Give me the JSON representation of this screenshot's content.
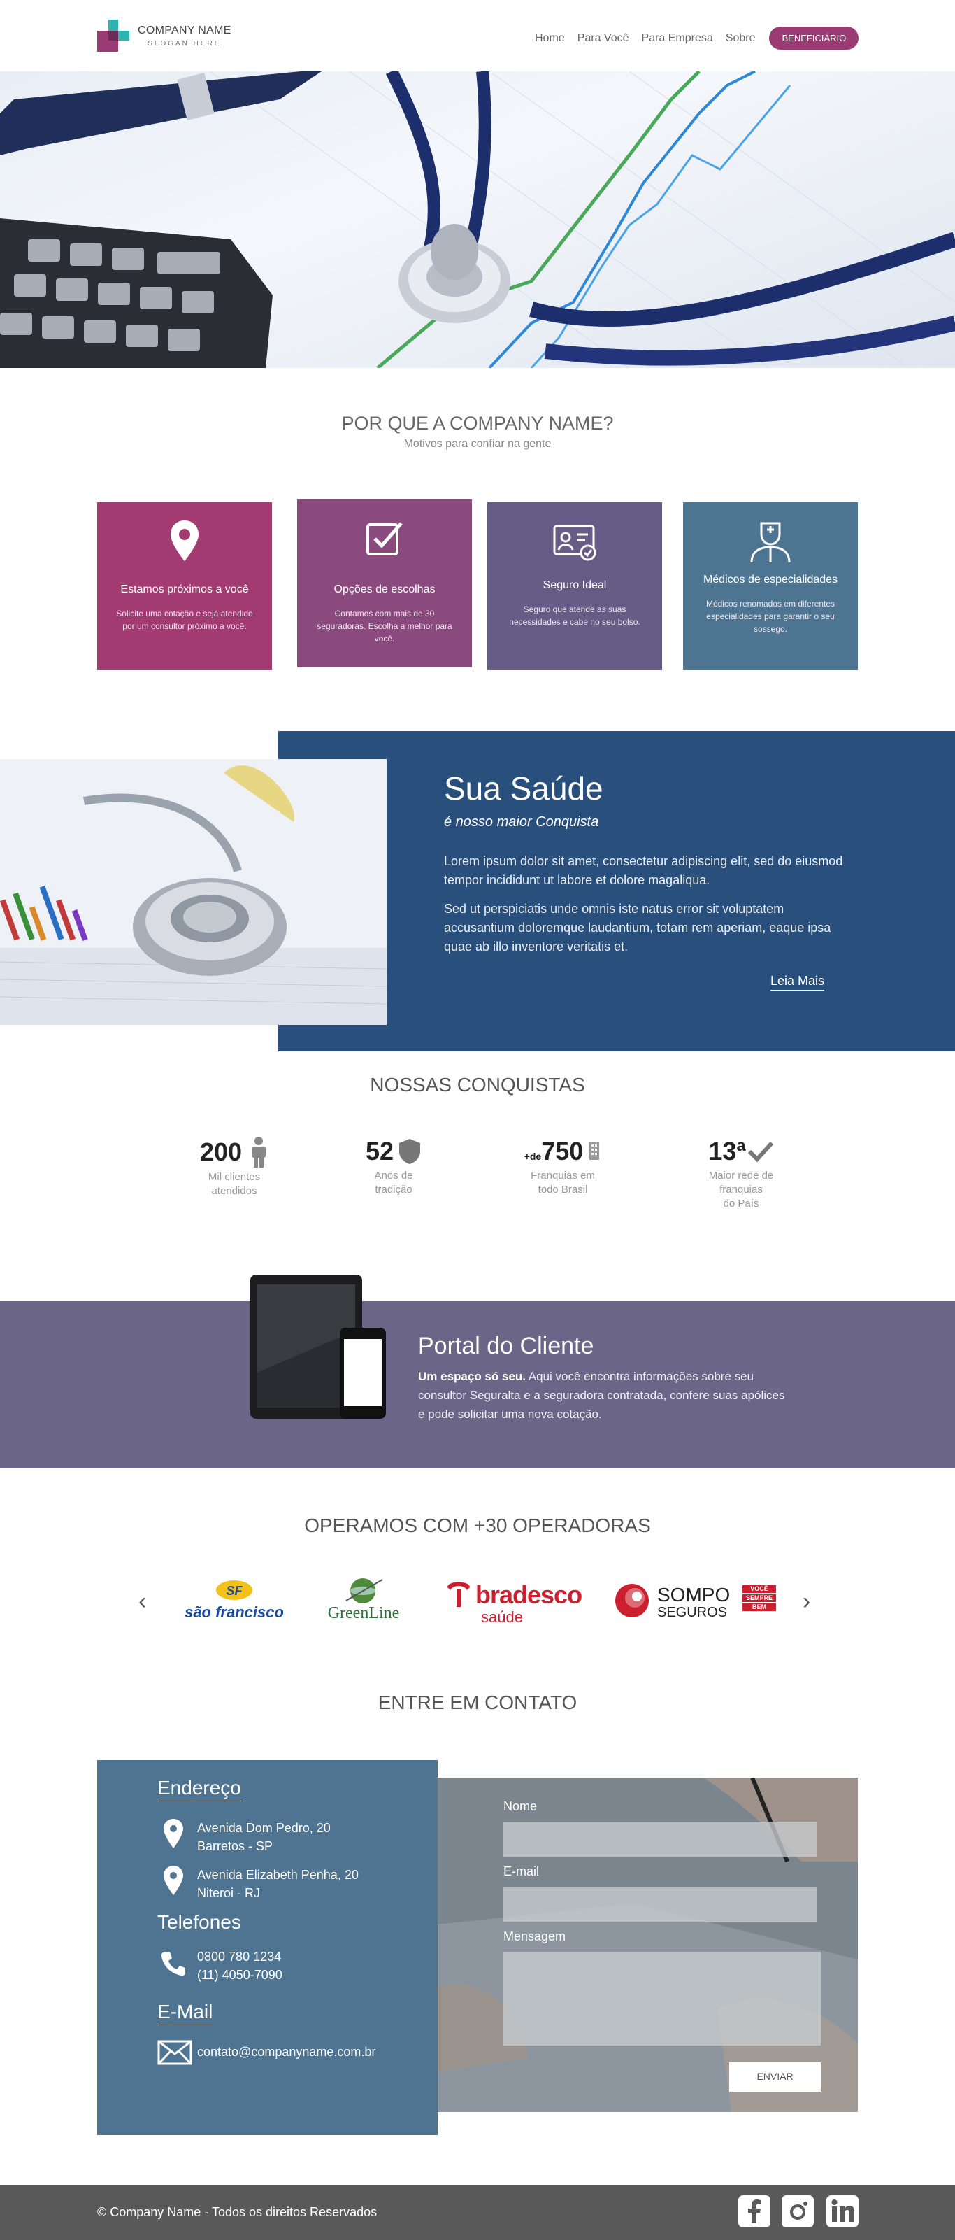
{
  "header": {
    "company": "COMPANY NAME",
    "slogan": "SLOGAN HERE",
    "nav": [
      "Home",
      "Para Você",
      "Para Empresa",
      "Sobre"
    ],
    "cta": "BENEFICIÁRIO"
  },
  "why": {
    "title": "POR QUE A COMPANY NAME?",
    "subtitle": "Motivos para confiar na gente",
    "cards": [
      {
        "icon": "map-pin-icon",
        "title": "Estamos próximos a você",
        "text": "Solicite uma cotação e seja atendido por um consultor próximo a você.",
        "color": "#a23b72"
      },
      {
        "icon": "check-box-icon",
        "title": "Opções de escolhas",
        "text": "Contamos com mais de 30 seguradoras. Escolha a melhor para você.",
        "color": "#8a4a7d"
      },
      {
        "icon": "id-card-icon",
        "title": "Seguro Ideal",
        "text": "Seguro que atende as suas necessidades e cabe no seu bolso.",
        "color": "#675c86"
      },
      {
        "icon": "doctor-icon",
        "title": "Médicos de especialidades",
        "text": "Médicos renomados em diferentes especialidades para garantir o seu sossego.",
        "color": "#4d7591"
      }
    ]
  },
  "saude": {
    "title": "Sua Saúde",
    "subtitle": "é nosso maior Conquista",
    "p1": "Lorem ipsum dolor sit amet, consectetur adipiscing elit, sed do eiusmod tempor incididunt ut labore et dolore magaliqua.",
    "p2": "Sed ut perspiciatis unde omnis iste natus error sit voluptatem accusantium doloremque laudantium, totam rem aperiam, eaque ipsa quae ab illo inventore veritatis et.",
    "link": "Leia Mais"
  },
  "conquistas": {
    "title": "NOSSAS CONQUISTAS",
    "stats": [
      {
        "number": "200",
        "label1": "Mil clientes",
        "label2": "atendidos",
        "icon": "person-icon"
      },
      {
        "number": "52",
        "label1": "Anos de",
        "label2": "tradição",
        "icon": "shield-icon"
      },
      {
        "prefix": "+de",
        "number": "750",
        "label1": "Franquias em",
        "label2": "todo Brasil",
        "icon": "building-icon"
      },
      {
        "number": "13ª",
        "label1": "Maior rede de",
        "label2": "franquias",
        "label3": "do País",
        "icon": "check-icon"
      }
    ]
  },
  "portal": {
    "title": "Portal do Cliente",
    "lead": "Um espaço só seu.",
    "text": " Aqui você encontra informações sobre seu consultor Seguralta e a seguradora contratada, confere suas apólices e pode solicitar uma nova cotação."
  },
  "operadoras": {
    "title": "OPERAMOS COM +30 OPERADORAS",
    "logos": [
      {
        "name": "são francisco",
        "color": "#1b4b9b"
      },
      {
        "name": "GreenLine",
        "color": "#2f6e3a"
      },
      {
        "name": "bradesco",
        "sub": "saúde",
        "color": "#cc1f2f"
      },
      {
        "name": "SOMPO",
        "sub": "SEGUROS",
        "tag1": "VOCÊ",
        "tag2": "SEMPRE",
        "tag3": "BEM",
        "color": "#222222"
      }
    ]
  },
  "contato": {
    "title": "ENTRE EM CONTATO",
    "endereco_h": "Endereço",
    "addr1_l1": "Avenida Dom Pedro, 20",
    "addr1_l2": "Barretos - SP",
    "addr2_l1": "Avenida Elizabeth Penha, 20",
    "addr2_l2": "Niteroi - RJ",
    "telefones_h": "Telefones",
    "tel1": "0800 780 1234",
    "tel2": "(11) 4050-7090",
    "email_h": "E-Mail",
    "email": "contato@companyname.com.br",
    "form": {
      "nome": "Nome",
      "email": "E-mail",
      "mensagem": "Mensagem",
      "enviar": "ENVIAR"
    }
  },
  "footer": {
    "text": "© Company Name - Todos os direitos Reservados",
    "social": [
      "facebook-icon",
      "instagram-icon",
      "linkedin-icon"
    ]
  }
}
